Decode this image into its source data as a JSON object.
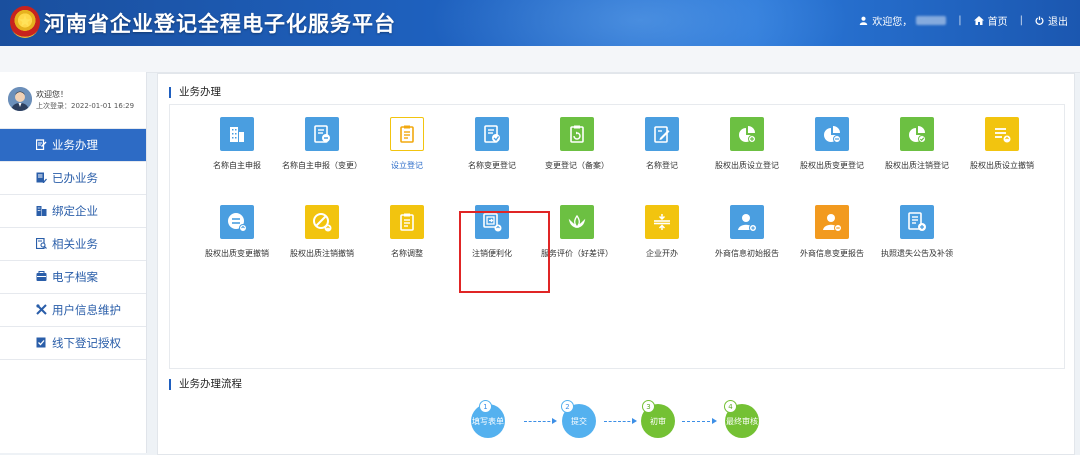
{
  "header": {
    "title": "河南省企业登记全程电子化服务平台",
    "welcome": "欢迎您，",
    "home": "首页",
    "logout": "退出"
  },
  "user": {
    "greeting": "欢迎您！",
    "last_login": "上次登录：2022-01-01 16:29"
  },
  "nav": [
    {
      "label": "业务办理",
      "icon": "edit-icon"
    },
    {
      "label": "已办业务",
      "icon": "done-doc-icon"
    },
    {
      "label": "绑定企业",
      "icon": "building-icon"
    },
    {
      "label": "相关业务",
      "icon": "search-doc-icon"
    },
    {
      "label": "电子档案",
      "icon": "archive-icon"
    },
    {
      "label": "用户信息维护",
      "icon": "tools-icon"
    },
    {
      "label": "线下登记授权",
      "icon": "stamp-icon"
    }
  ],
  "business": {
    "title": "业务办理",
    "tiles": [
      "名称自主申报",
      "名称自主申报（变更）",
      "设立登记",
      "名称变更登记",
      "变更登记（备案）",
      "名称登记",
      "股权出质设立登记",
      "股权出质变更登记",
      "股权出质注销登记",
      "股权出质设立撤销",
      "股权出质变更撤销",
      "股权出质注销撤销",
      "名称调整",
      "注销便利化",
      "服务评价（好差评）",
      "企业开办",
      "外商信息初始报告",
      "外商信息变更报告",
      "执照遗失公告及补领"
    ]
  },
  "flow": {
    "title": "业务办理流程",
    "steps": [
      {
        "num": "1",
        "label": "填写表单"
      },
      {
        "num": "2",
        "label": "提交"
      },
      {
        "num": "3",
        "label": "初审"
      },
      {
        "num": "4",
        "label": "最终审核"
      }
    ]
  },
  "colors": {
    "blue": "#4a9ee0",
    "green": "#6cc042",
    "yellow": "#f2c40f",
    "orange": "#f29a1f",
    "accent": "#2d6bc5",
    "highlight": "#e02525"
  }
}
